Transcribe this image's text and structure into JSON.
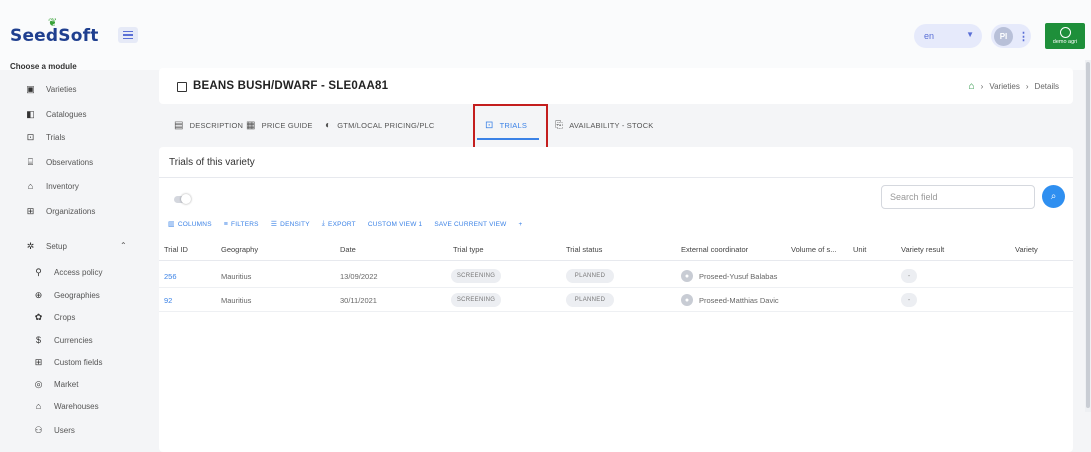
{
  "header": {
    "logo_text": "SeedSoft",
    "language": "en",
    "user_initials": "PI",
    "demo_logo_text": "demo agri"
  },
  "sidebar": {
    "heading": "Choose a module",
    "items": [
      {
        "label": "Varieties",
        "icon": "varieties-icon"
      },
      {
        "label": "Catalogues",
        "icon": "catalogue-icon"
      },
      {
        "label": "Trials",
        "icon": "trials-icon"
      },
      {
        "label": "Observations",
        "icon": "observations-icon"
      },
      {
        "label": "Inventory",
        "icon": "inventory-icon"
      },
      {
        "label": "Organizations",
        "icon": "organizations-icon"
      }
    ],
    "setup_label": "Setup",
    "setup_items": [
      {
        "label": "Access policy",
        "icon": "access-policy-icon"
      },
      {
        "label": "Geographies",
        "icon": "geographies-icon"
      },
      {
        "label": "Crops",
        "icon": "crops-icon"
      },
      {
        "label": "Currencies",
        "icon": "currencies-icon"
      },
      {
        "label": "Custom fields",
        "icon": "custom-fields-icon"
      },
      {
        "label": "Market",
        "icon": "market-icon"
      },
      {
        "label": "Warehouses",
        "icon": "warehouses-icon"
      },
      {
        "label": "Users",
        "icon": "users-icon"
      }
    ]
  },
  "page": {
    "title": "BEANS BUSH/DWARF - SLE0AA81",
    "breadcrumb": [
      "Varieties",
      "Details"
    ]
  },
  "tabs": [
    {
      "label": "DESCRIPTION",
      "icon": "document-icon"
    },
    {
      "label": "PRICE GUIDE",
      "icon": "price-tag-icon"
    },
    {
      "label": "GTM/LOCAL PRICING/PLC",
      "icon": "globe-icon"
    },
    {
      "label": "TRIALS",
      "icon": "trials-icon",
      "active": true
    },
    {
      "label": "AVAILABILITY - STOCK",
      "icon": "clipboard-icon"
    }
  ],
  "panel": {
    "subtitle": "Trials of this variety",
    "search_placeholder": "Search field"
  },
  "toolbar": {
    "columns": "COLUMNS",
    "filters": "FILTERS",
    "density": "DENSITY",
    "export": "EXPORT",
    "custom_view": "CUSTOM VIEW 1",
    "save_view": "SAVE CURRENT VIEW",
    "add": "+"
  },
  "table": {
    "columns": [
      "Trial ID",
      "Geography",
      "Date",
      "Trial type",
      "Trial status",
      "External coordinator",
      "Volume of s...",
      "Unit",
      "Variety result",
      "Variety"
    ],
    "rows": [
      {
        "trial_id": "256",
        "geography": "Mauritius",
        "date": "13/09/2022",
        "trial_type": "SCREENING",
        "trial_status": "PLANNED",
        "coordinator": "Proseed-Yusuf Balabas",
        "variety_result": "-"
      },
      {
        "trial_id": "92",
        "geography": "Mauritius",
        "date": "30/11/2021",
        "trial_type": "SCREENING",
        "trial_status": "PLANNED",
        "coordinator": "Proseed-Matthias Davic",
        "variety_result": "-"
      }
    ]
  },
  "colors": {
    "accent": "#3b82e6",
    "highlight": "#c41e1e",
    "brand_green": "#1e8f3a",
    "logo_blue": "#1f3f8f"
  }
}
